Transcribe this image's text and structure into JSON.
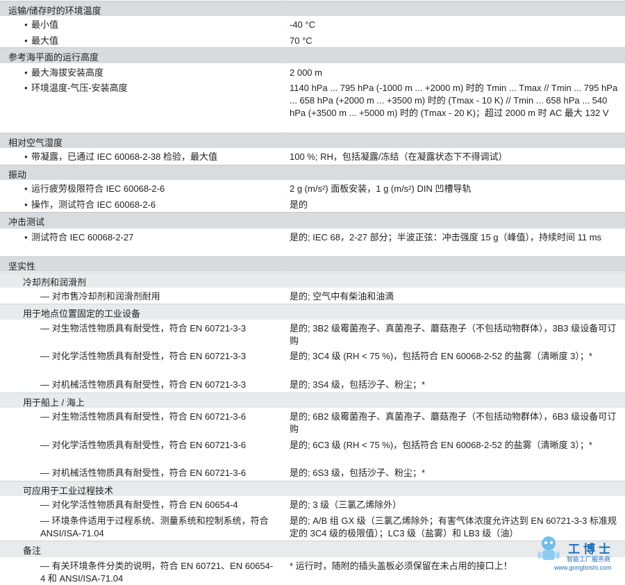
{
  "sections": [
    {
      "kind": "sec",
      "text": "运输/储存时的环境温度"
    },
    {
      "kind": "item",
      "bullet": true,
      "label": "最小值",
      "value": "-40 °C"
    },
    {
      "kind": "item",
      "bullet": true,
      "label": "最大值",
      "value": "70 °C"
    },
    {
      "kind": "sec",
      "text": "参考海平面的运行高度"
    },
    {
      "kind": "item",
      "bullet": true,
      "label": "最大海拔安装高度",
      "value": "2 000 m"
    },
    {
      "kind": "item",
      "bullet": true,
      "label": "环境温度-气压-安装高度",
      "value": "1140 hPa ... 795 hPa (-1000 m ... +2000 m) 时的 Tmin ... Tmax // Tmin ... 795 hPa ... 658 hPa (+2000 m ... +3500 m) 时的 (Tmax - 10 K) // Tmin ... 658 hPa ... 540 hPa (+3500 m ... +5000 m) 时的 (Tmax - 20 K)；超过 2000 m 时 AC 最大 132 V"
    },
    {
      "kind": "sec",
      "text": "相对空气湿度"
    },
    {
      "kind": "item",
      "bullet": true,
      "label": "带凝露，已通过 IEC 60068-2-38 检验，最大值",
      "value": "100 %; RH，包括凝露/冻结（在凝露状态下不得调试）"
    },
    {
      "kind": "sec",
      "text": "振动"
    },
    {
      "kind": "item",
      "bullet": true,
      "label": "运行疲劳极限符合 IEC 60068-2-6",
      "value": "2 g (m/s²) 面板安装，1 g (m/s²) DIN 凹槽导轨"
    },
    {
      "kind": "item",
      "bullet": true,
      "label": "操作，测试符合 IEC 60068-2-6",
      "value": "是的"
    },
    {
      "kind": "sec",
      "text": "冲击测试"
    },
    {
      "kind": "item",
      "bullet": true,
      "label": "测试符合 IEC 60068-2-27",
      "value": "是的; IEC 68，2-27 部分；半波正弦：冲击强度 15 g（峰值），持续时间 11 ms"
    },
    {
      "kind": "sec",
      "text": "坚实性"
    },
    {
      "kind": "sub",
      "text": "冷却剂和润滑剂"
    },
    {
      "kind": "item",
      "dash": true,
      "label": "— 对市售冷却剂和润滑剂耐用",
      "value": "是的; 空气中有柴油和油滴"
    },
    {
      "kind": "sub",
      "text": "用于地点位置固定的工业设备"
    },
    {
      "kind": "item",
      "dash": true,
      "label": "— 对生物活性物质具有耐受性，符合 EN 60721-3-3",
      "value": "是的; 3B2 级霉菌孢子、真菌孢子、蘑菇孢子（不包括动物群体），3B3 级设备可订购"
    },
    {
      "kind": "item",
      "dash": true,
      "label": "— 对化学活性物质具有耐受性，符合 EN 60721-3-3",
      "value": "是的; 3C4 级 (RH < 75 %)，包括符合 EN 60068-2-52 的盐雾（清晰度 3）；*"
    },
    {
      "kind": "item",
      "dash": true,
      "label": "— 对机械活性物质具有耐受性，符合 EN 60721-3-3",
      "value": "是的; 3S4 级，包括沙子、粉尘；*"
    },
    {
      "kind": "sub",
      "text": "用于船上 / 海上"
    },
    {
      "kind": "item",
      "dash": true,
      "label": "— 对生物活性物质具有耐受性，符合 EN 60721-3-6",
      "value": "是的; 6B2 级霉菌孢子、真菌孢子、蘑菇孢子（不包括动物群体），6B3 级设备可订购"
    },
    {
      "kind": "item",
      "dash": true,
      "label": "— 对化学活性物质具有耐受性，符合 EN 60721-3-6",
      "value": "是的; 6C3 级 (RH < 75 %)，包括符合 EN 60068-2-52 的盐雾（清晰度 3）；*"
    },
    {
      "kind": "item",
      "dash": true,
      "label": "— 对机械活性物质具有耐受性，符合 EN 60721-3-6",
      "value": "是的; 6S3 级，包括沙子、粉尘；*"
    },
    {
      "kind": "sub",
      "text": "可应用于工业过程技术"
    },
    {
      "kind": "item",
      "dash": true,
      "label": "— 对化学活性物质具有耐受性，符合 EN 60654-4",
      "value": "是的; 3 级（三氯乙烯除外）"
    },
    {
      "kind": "item",
      "dash": true,
      "label": "— 环境条件适用于过程系统、测量系统和控制系统，符合 ANSI/ISA-71.04",
      "value": "是的; A/B 组 GX 级（三氯乙烯除外；有害气体浓度允许达到 EN 60721-3-3 标准规定的 3C4 级的极限值）；LC3 级（盐雾）和 LB3 级（油）"
    },
    {
      "kind": "sub",
      "text": "备注"
    },
    {
      "kind": "item",
      "dash": true,
      "label": "— 有关环境条件分类的说明，符合 EN 60721、EN 60654-4 和 ANSI/ISA-71.04",
      "value": "* 运行时，随附的插头盖板必须保留在未占用的接口上！"
    }
  ],
  "watermark": {
    "brand": "工博士",
    "tagline": "智能工厂服务商",
    "url": "www.gongboshi.com"
  }
}
